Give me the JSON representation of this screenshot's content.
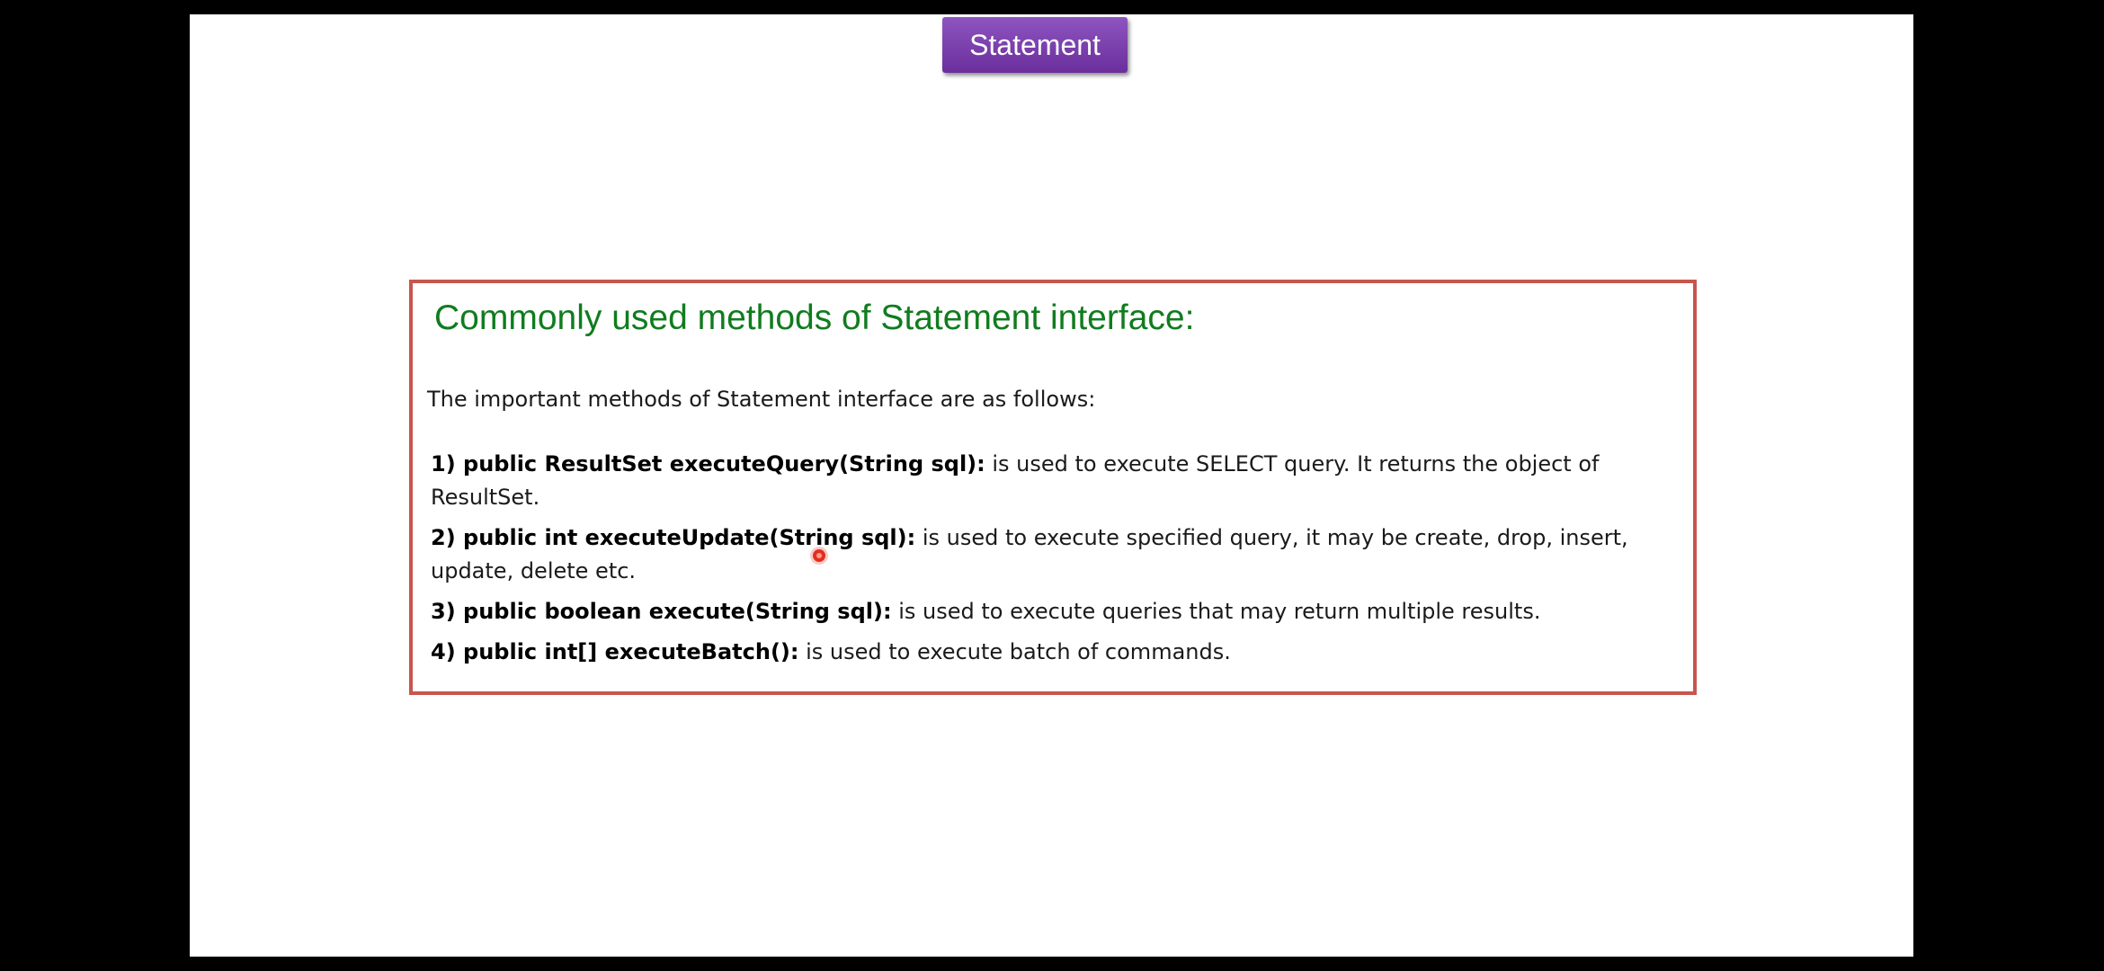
{
  "slide": {
    "title_tab": "Statement",
    "heading": "Commonly used methods of Statement interface:",
    "intro": "The important methods of Statement interface are as follows:",
    "methods": [
      {
        "signature": "1) public ResultSet executeQuery(String sql):",
        "description": " is used to execute SELECT query. It returns the object of ResultSet."
      },
      {
        "signature": "2) public int executeUpdate(String sql):",
        "description": " is used to execute specified query, it may be create, drop, insert, update, delete etc."
      },
      {
        "signature": "3) public boolean execute(String sql):",
        "description": " is used to execute queries that may return multiple results."
      },
      {
        "signature": "4) public int[] executeBatch():",
        "description": " is used to execute batch of commands."
      }
    ]
  },
  "colors": {
    "tab_background": "#7b41ad",
    "heading_text": "#107c1e",
    "box_border": "#c8564c",
    "cursor_highlight": "#e03020"
  }
}
